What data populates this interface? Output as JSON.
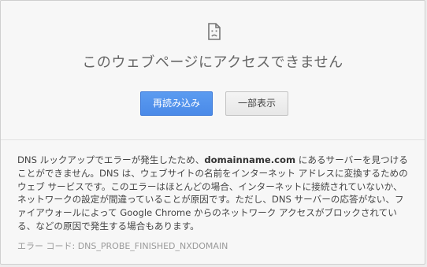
{
  "page": {
    "title": "このウェブページにアクセスできません",
    "icon": "sad-page-icon"
  },
  "buttons": {
    "reload_label": "再読み込み",
    "details_label": "一部表示"
  },
  "details": {
    "text_before": "DNS ルックアップでエラーが発生したため、",
    "domain": "domainname.com",
    "text_after": " にあるサーバーを見つけることができません。DNS は、ウェブサイトの名前をインターネット アドレスに変換するためのウェブ サービスです。このエラーはほとんどの場合、インターネットに接続されていないか、ネットワークの設定が間違っていることが原因です。ただし、DNS サーバーの応答がない、ファイアウォールによって Google Chrome からのネットワーク アクセスがブロックされている、などの原因で発生する場合もあります。"
  },
  "error": {
    "code_label": "エラー コード: DNS_PROBE_FINISHED_NXDOMAIN"
  },
  "colors": {
    "primary_button": "#4a8ae8",
    "background": "#f7f7f7",
    "text": "#444444"
  }
}
